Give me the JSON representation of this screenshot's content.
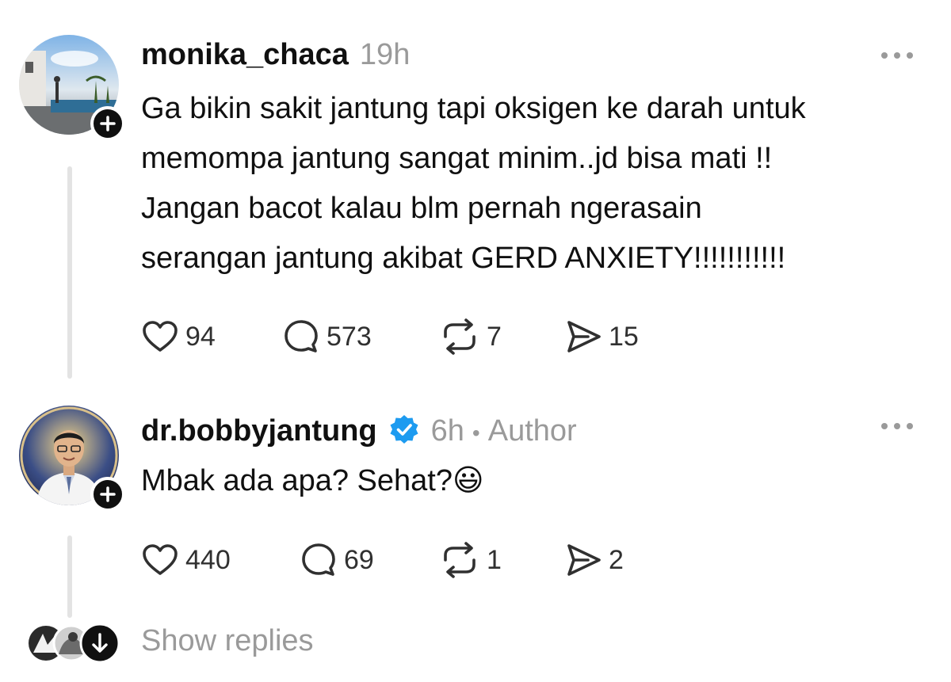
{
  "posts": [
    {
      "username": "monika_chaca",
      "time": "19h",
      "author_tag": "",
      "verified": false,
      "text_lines": [
        "Ga bikin sakit jantung tapi oksigen ke darah untuk",
        "memompa jantung sangat minim..jd bisa mati !!",
        "Jangan bacot kalau blm pernah ngerasain",
        "serangan jantung akibat GERD ANXIETY!!!!!!!!!!!"
      ],
      "likes": "94",
      "replies": "573",
      "reposts": "7",
      "shares": "15"
    },
    {
      "username": "dr.bobbyjantung",
      "time": "6h",
      "separator": "•",
      "author_tag": "Author",
      "verified": true,
      "text_lines": [
        "Mbak ada apa? Sehat?😃"
      ],
      "likes": "440",
      "replies": "69",
      "reposts": "1",
      "shares": "2"
    }
  ],
  "show_replies_label": "Show replies",
  "icons": {
    "like": "heart-icon",
    "reply": "comment-icon",
    "repost": "repost-icon",
    "share": "send-icon",
    "more": "more-icon",
    "follow": "plus-icon",
    "verified": "verified-badge-icon",
    "expand": "arrow-down-icon"
  },
  "colors": {
    "verified": "#1d9bf0",
    "muted": "#9a9a9a",
    "text": "#101010"
  }
}
